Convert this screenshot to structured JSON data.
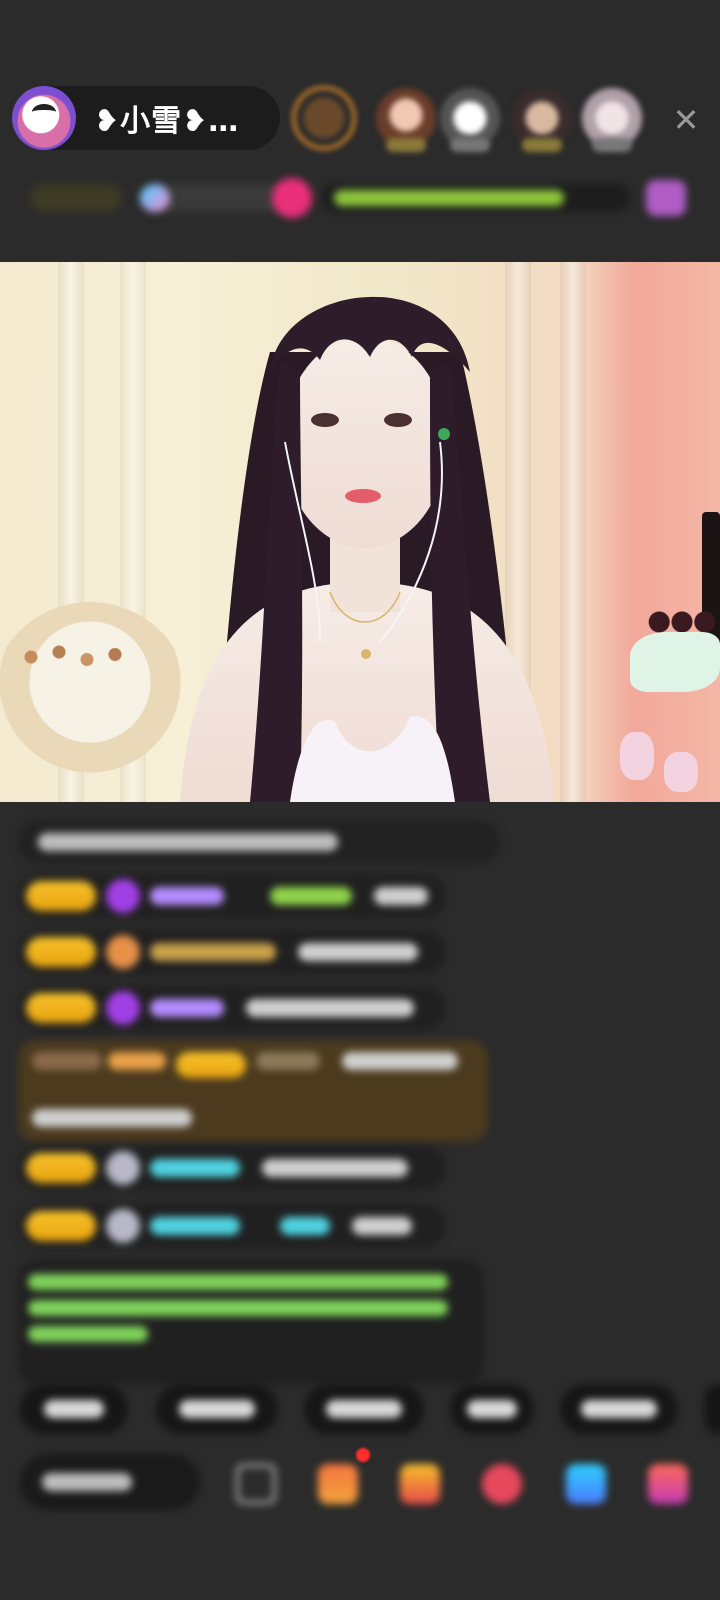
{
  "header": {
    "host_name": "❥小雪❥…",
    "close_symbol": "✕"
  },
  "colors": {
    "background": "#2b2b2b",
    "badge_yellow": "#f6c12a",
    "username_purple": "#b48cff",
    "username_cyan": "#4fd2e0",
    "username_green": "#8fd34a",
    "system_text_green": "#7fd35a"
  },
  "icons": {
    "close": "close-icon",
    "gift": "gift-icon",
    "share": "share-icon",
    "emoji": "emoji-icon"
  }
}
